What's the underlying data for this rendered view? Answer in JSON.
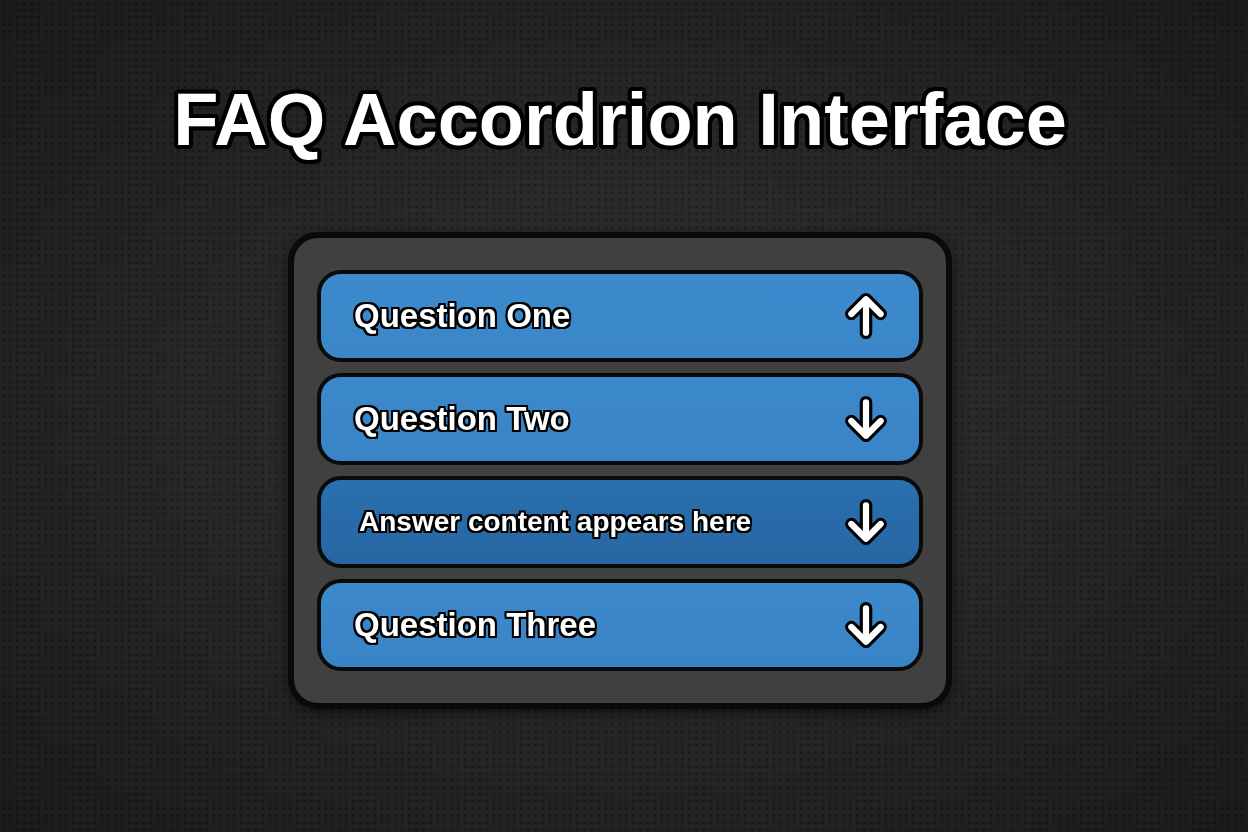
{
  "title": "FAQ Accordrion Interface",
  "accordion": {
    "items": [
      {
        "kind": "question",
        "label": "Question One",
        "expanded": true
      },
      {
        "kind": "question",
        "label": "Question Two",
        "expanded": false
      },
      {
        "kind": "answer",
        "label": "Answer content appears here",
        "expanded": false
      },
      {
        "kind": "question",
        "label": "Question Three",
        "expanded": false
      }
    ]
  }
}
